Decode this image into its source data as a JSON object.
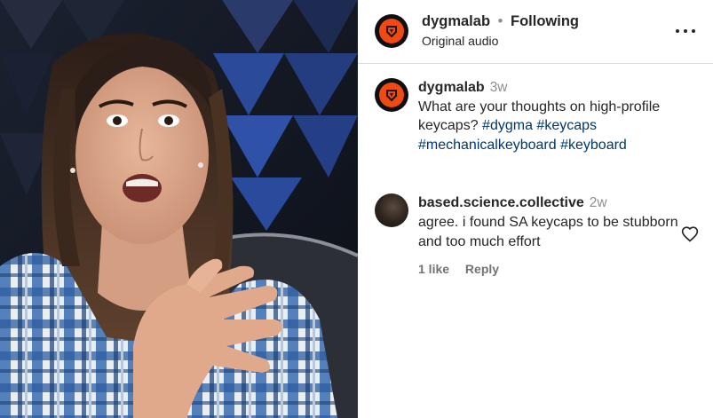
{
  "post": {
    "author": "dygmalab",
    "separator": "•",
    "follow_state": "Following",
    "audio": "Original audio",
    "more_icon": "more-horizontal-icon",
    "brand_color": "#f04a12"
  },
  "caption": {
    "author": "dygmalab",
    "time": "3w",
    "text": "What are your thoughts on high-profile keycaps?",
    "hashtags": [
      "#dygma",
      "#keycaps",
      "#mechanicalkeyboard",
      "#keyboard"
    ]
  },
  "comments": [
    {
      "user": "based.science.collective",
      "time": "2w",
      "text": "agree. i found SA keycaps to be stubborn and too much effort",
      "likes": "1 like",
      "reply": "Reply",
      "like_icon": "heart-outline-icon"
    }
  ]
}
